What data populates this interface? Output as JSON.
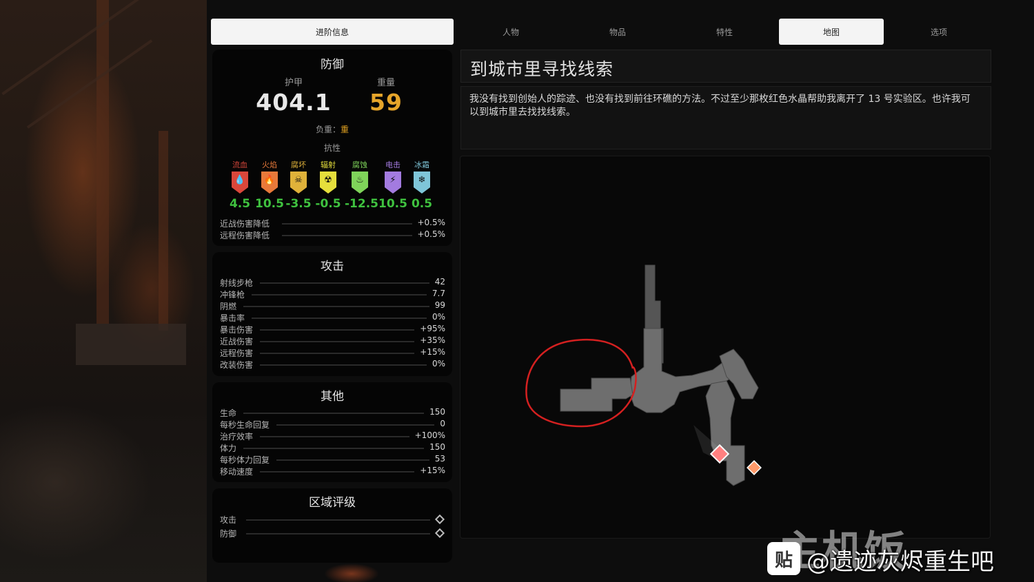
{
  "tabs": [
    {
      "label": "进阶信息",
      "active": true
    },
    {
      "label": "人物",
      "active": false
    },
    {
      "label": "物品",
      "active": false
    },
    {
      "label": "特性",
      "active": false
    },
    {
      "label": "地图",
      "active": true
    },
    {
      "label": "选项",
      "active": false
    }
  ],
  "defense": {
    "title": "防御",
    "armor_label": "护甲",
    "armor_value": "404.1",
    "weight_label": "重量",
    "weight_value": "59",
    "load_label": "负重：",
    "load_value": "重",
    "resist_title": "抗性",
    "resistances": [
      {
        "name": "流血",
        "value": "4.5",
        "color": "#d9473b",
        "icon": "blood-drop-icon",
        "glyph": "💧"
      },
      {
        "name": "火焰",
        "value": "10.5",
        "color": "#e8793a",
        "icon": "flame-icon",
        "glyph": "🔥"
      },
      {
        "name": "腐坏",
        "value": "-3.5",
        "color": "#e0b23a",
        "icon": "skull-icon",
        "glyph": "☠"
      },
      {
        "name": "辐射",
        "value": "-0.5",
        "color": "#e6df3c",
        "icon": "radiation-icon",
        "glyph": "☢"
      },
      {
        "name": "腐蚀",
        "value": "-12.5",
        "color": "#7fd45a",
        "icon": "acid-icon",
        "glyph": "♨"
      },
      {
        "name": "电击",
        "value": "10.5",
        "color": "#a37be0",
        "icon": "lightning-icon",
        "glyph": "⚡"
      },
      {
        "name": "冰霜",
        "value": "0.5",
        "color": "#7fc6d9",
        "icon": "snowflake-icon",
        "glyph": "❄"
      }
    ],
    "rows": [
      {
        "label": "近战伤害降低",
        "value": "+0.5%"
      },
      {
        "label": "远程伤害降低",
        "value": "+0.5%"
      }
    ]
  },
  "attack": {
    "title": "攻击",
    "rows": [
      {
        "label": "射线步枪",
        "value": "42"
      },
      {
        "label": "冲锋枪",
        "value": "7.7"
      },
      {
        "label": "阴燃",
        "value": "99"
      },
      {
        "label": "暴击率",
        "value": "0%"
      },
      {
        "label": "暴击伤害",
        "value": "+95%"
      },
      {
        "label": "近战伤害",
        "value": "+35%"
      },
      {
        "label": "远程伤害",
        "value": "+15%"
      },
      {
        "label": "改装伤害",
        "value": "0%"
      }
    ]
  },
  "other": {
    "title": "其他",
    "rows": [
      {
        "label": "生命",
        "value": "150"
      },
      {
        "label": "每秒生命回复",
        "value": "0"
      },
      {
        "label": "治疗效率",
        "value": "+100%"
      },
      {
        "label": "体力",
        "value": "150"
      },
      {
        "label": "每秒体力回复",
        "value": "53"
      },
      {
        "label": "移动速度",
        "value": "+15%"
      }
    ]
  },
  "zone": {
    "title": "区域评级",
    "rows": [
      {
        "label": "攻击"
      },
      {
        "label": "防御"
      }
    ]
  },
  "quest": {
    "title": "到城市里寻找线索",
    "description": "我没有找到创始人的踪迹、也没有找到前往环礁的方法。不过至少那枚红色水晶帮助我离开了 13 号实验区。也许我可以到城市里去找找线索。"
  },
  "watermark": {
    "logo": "贴",
    "brand": "主机饭",
    "text": "@遗迹灰烬重生吧"
  },
  "colors": {
    "armor": "#e8e8e8",
    "weight": "#e6a52a",
    "resist_value": "#3fc23f",
    "map_marker": "#ff6b6b",
    "annotation_circle": "#d42020"
  }
}
